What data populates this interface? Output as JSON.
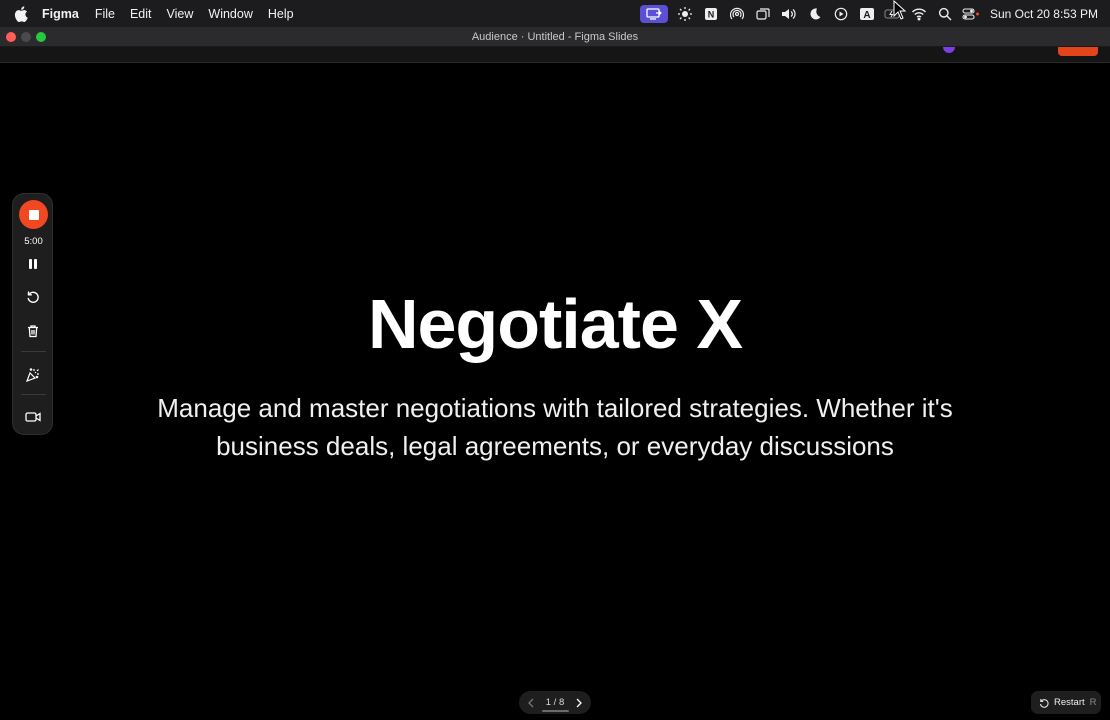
{
  "menubar": {
    "app_name": "Figma",
    "menus": [
      "File",
      "Edit",
      "View",
      "Window",
      "Help"
    ],
    "clock": "Sun Oct 20  8:53 PM",
    "tray_icons": [
      "screen-share-icon",
      "brightness-icon",
      "notion-icon",
      "airdrop-icon",
      "window-stack-icon",
      "volume-icon",
      "moon-icon",
      "play-circle-icon",
      "keyboard-input-icon",
      "battery-icon",
      "wifi-icon",
      "spotlight-search-icon",
      "control-center-icon"
    ],
    "keyboard_input_letter": "A",
    "notion_letter": "N"
  },
  "window": {
    "title": "Audience · Untitled - Figma Slides"
  },
  "slide": {
    "title": "Negotiate X",
    "subtitle": "Manage and master negotiations with tailored strategies. Whether it's business deals, legal agreements, or everyday discussions"
  },
  "tool_panel": {
    "timer": "5:00"
  },
  "navigation": {
    "counter": "1 / 8"
  },
  "restart": {
    "label": "Restart",
    "shortcut": "R"
  },
  "colors": {
    "accent_red": "#f24822",
    "tray_active": "#5b4fd6",
    "background": "#000000"
  }
}
